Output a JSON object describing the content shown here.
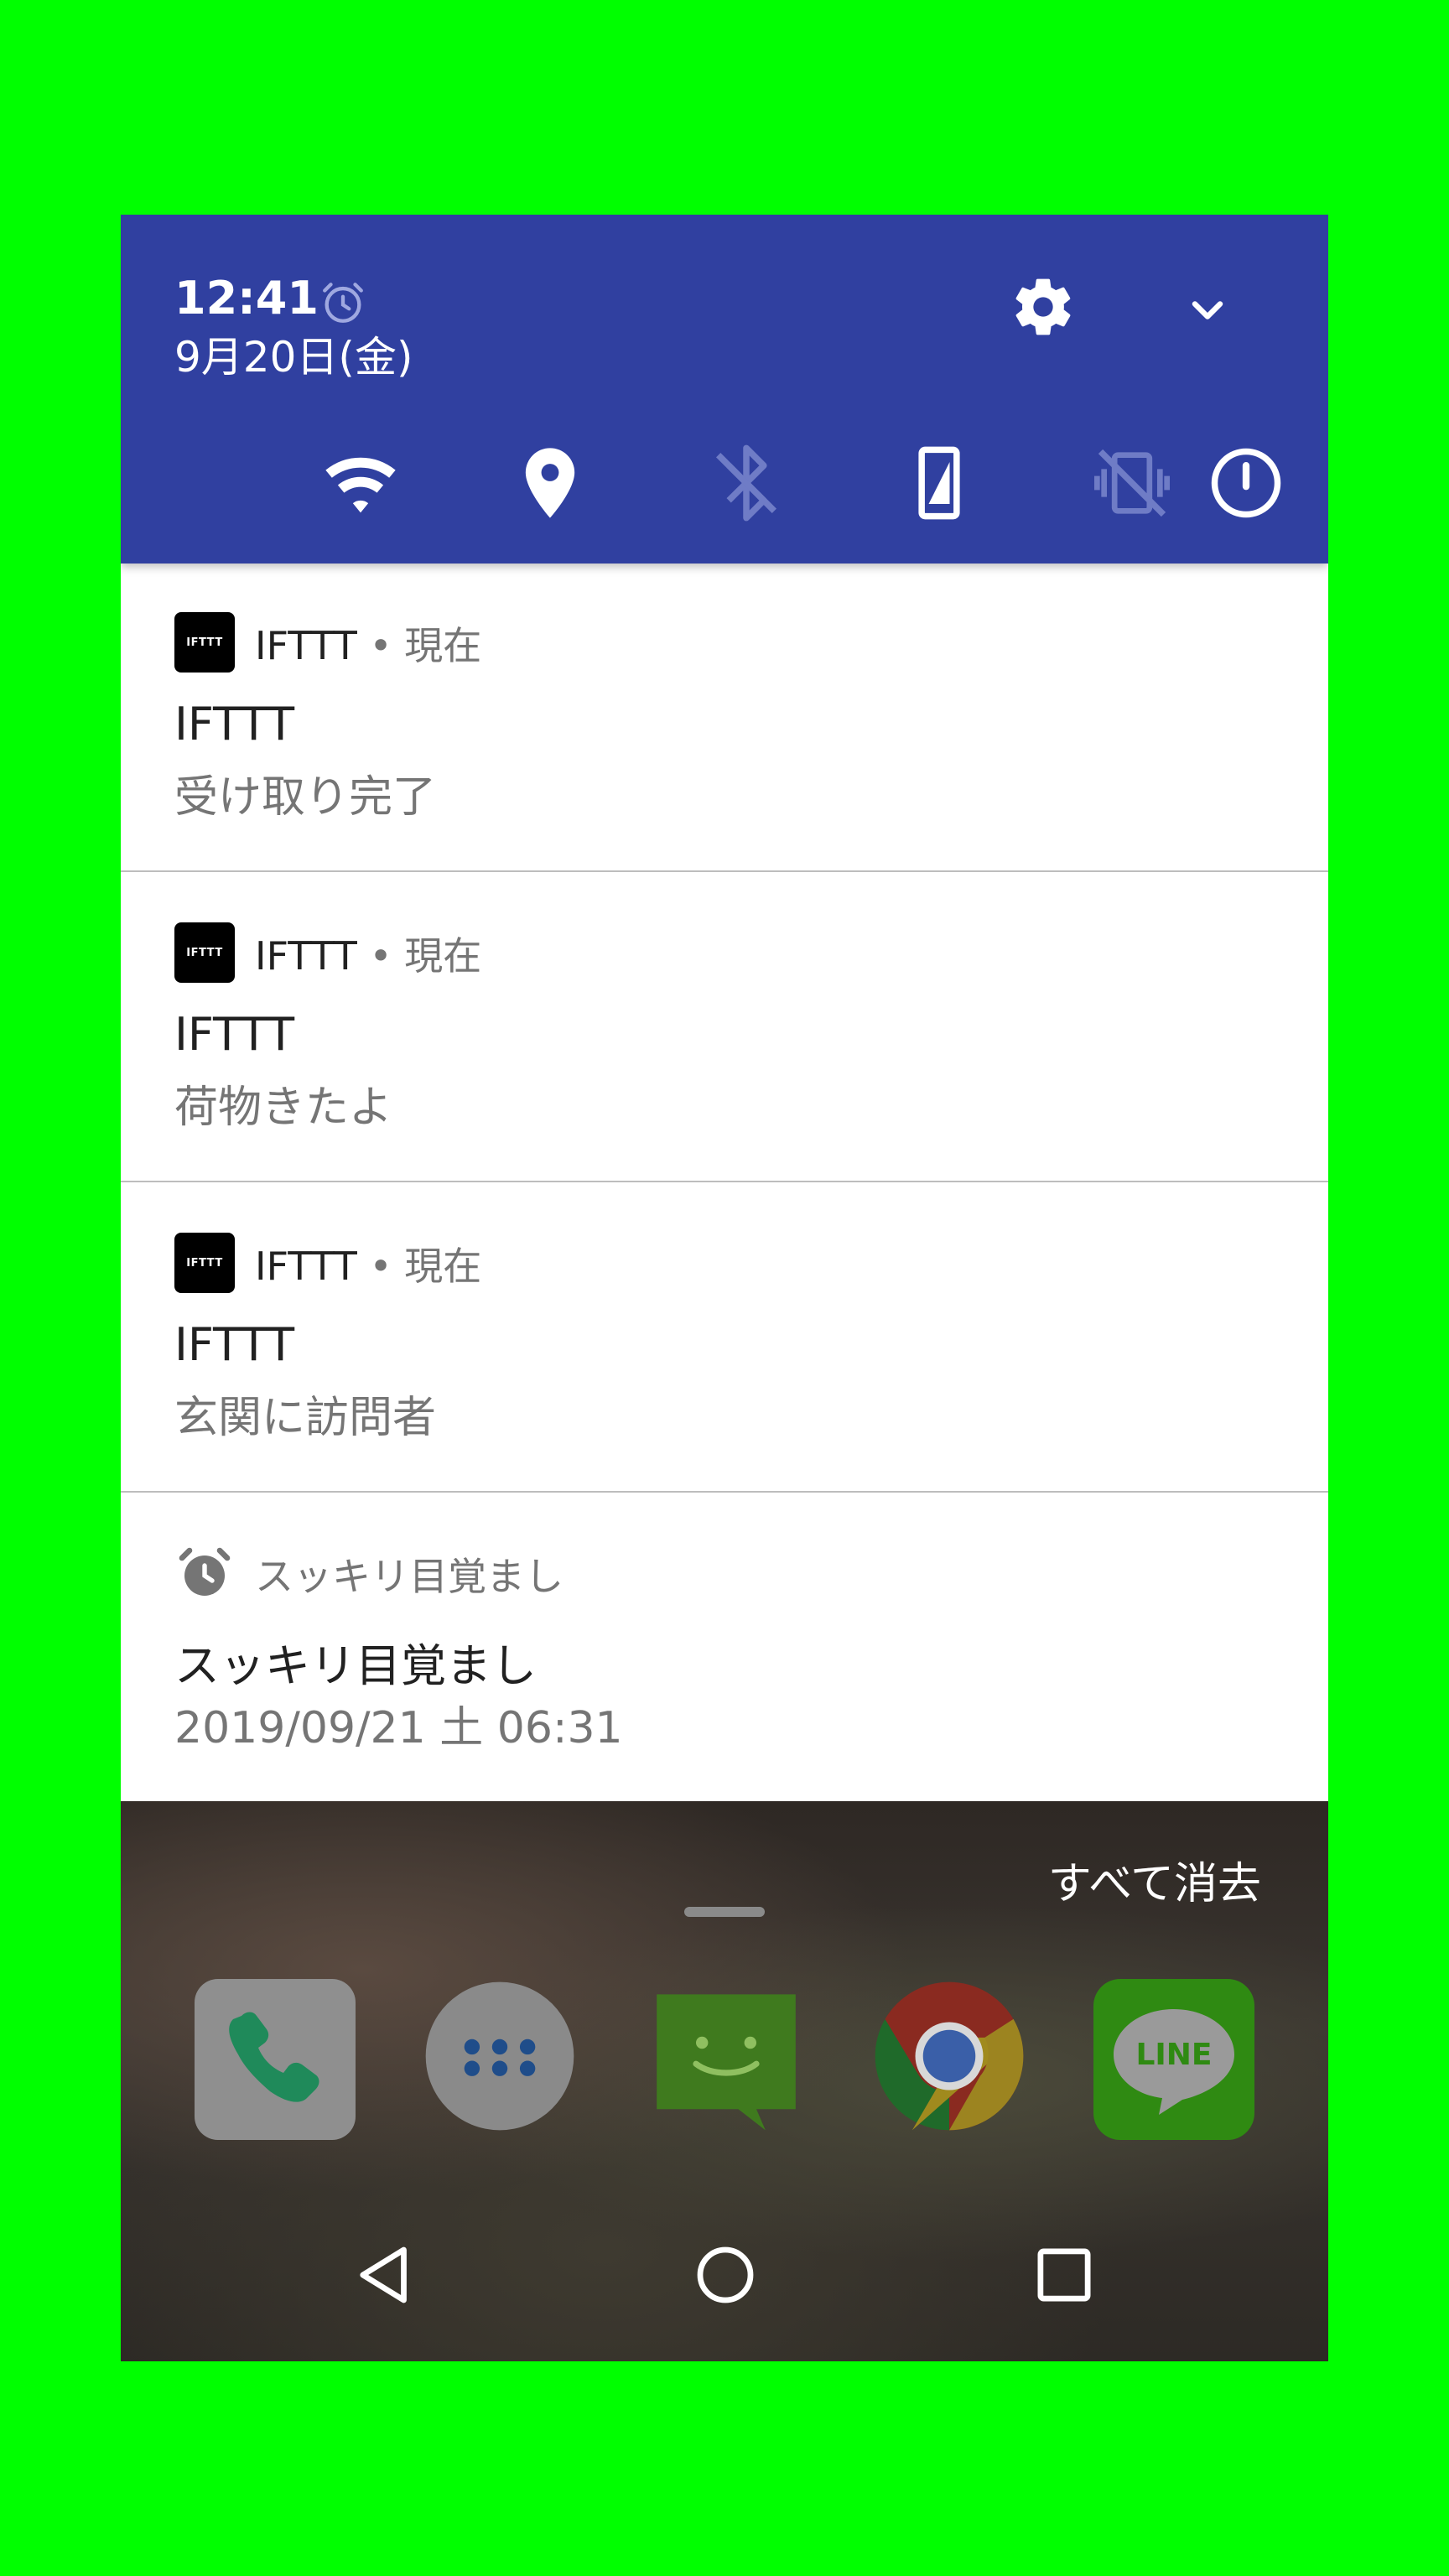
{
  "status": {
    "time": "12:41",
    "date": "9月20日(金)"
  },
  "quick_settings": {
    "icons": [
      "gear-icon",
      "chevron-down-icon"
    ],
    "tiles": [
      {
        "name": "wifi",
        "icon": "wifi-icon",
        "active": true
      },
      {
        "name": "location",
        "icon": "location-pin-icon",
        "active": true
      },
      {
        "name": "bluetooth",
        "icon": "bluetooth-off-icon",
        "active": false
      },
      {
        "name": "auto-rotate",
        "icon": "rotate-icon",
        "active": true
      },
      {
        "name": "vibrate",
        "icon": "vibrate-off-icon",
        "active": false
      },
      {
        "name": "power",
        "icon": "power-icon",
        "active": true
      }
    ]
  },
  "notifications": [
    {
      "app_icon_text": "IFTTT",
      "app": "IFTTT",
      "sep": " • ",
      "when": "現在",
      "title": "IFTTT",
      "text": "受け取り完了"
    },
    {
      "app_icon_text": "IFTTT",
      "app": "IFTTT",
      "sep": " • ",
      "when": "現在",
      "title": "IFTTT",
      "text": "荷物きたよ"
    },
    {
      "app_icon_text": "IFTTT",
      "app": "IFTTT",
      "sep": " • ",
      "when": "現在",
      "title": "IFTTT",
      "text": "玄関に訪問者"
    },
    {
      "app": "スッキリ目覚まし",
      "title": "スッキリ目覚まし",
      "text": "2019/09/21 土 06:31"
    }
  ],
  "home": {
    "clear_all_label": "すべて消去",
    "dock": [
      {
        "name": "phone",
        "icon": "phone-icon"
      },
      {
        "name": "app-drawer",
        "icon": "app-drawer-icon"
      },
      {
        "name": "messages",
        "icon": "messages-icon"
      },
      {
        "name": "chrome",
        "icon": "chrome-icon"
      },
      {
        "name": "line",
        "icon": "line-icon",
        "label": "LINE"
      }
    ],
    "nav": [
      "back-icon",
      "home-icon",
      "recents-icon"
    ]
  },
  "colors": {
    "header": "#3040a0",
    "background": "#00ff00"
  }
}
